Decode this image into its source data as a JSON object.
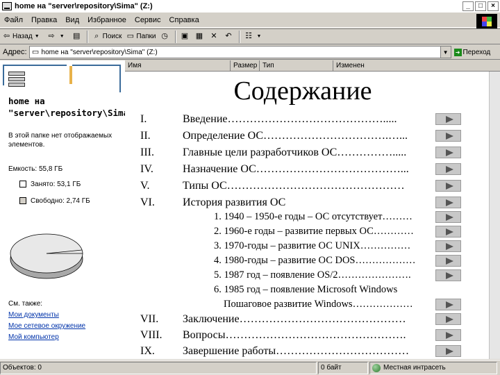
{
  "window": {
    "title": "home на \"server\\repository\\Sima\" (Z:)"
  },
  "menu": [
    "Файл",
    "Правка",
    "Вид",
    "Избранное",
    "Сервис",
    "Справка"
  ],
  "toolbar": {
    "back": "Назад",
    "search": "Поиск",
    "folders": "Папки"
  },
  "address": {
    "label": "Адрес:",
    "value": "home на \"server\\repository\\Sima\" (Z:)",
    "go": "Переход"
  },
  "columns": [
    "Имя",
    "Размер",
    "Тип",
    "Изменен"
  ],
  "left_panel": {
    "folder_title": "home на\n\"server\\repository\\Sima",
    "empty_text": "В этой папке нет отображаемых элементов.",
    "capacity": "Емкость: 55,8 ГБ",
    "used": "Занято: 53,1 ГБ",
    "free": "Свободно: 2,74 ГБ",
    "see_also": "См. также:",
    "links": [
      "Мои документы",
      "Мое сетевое окружение",
      "Мой компьютер"
    ],
    "used_color": "#ffffff",
    "free_color": "#d4d0c8"
  },
  "slide": {
    "title": "Содержание",
    "items": [
      {
        "num": "I.",
        "text": "Введение……………………………………....."
      },
      {
        "num": "II.",
        "text": "Определение ОС…………………………….…..."
      },
      {
        "num": "III.",
        "text": "Главные цели разработчиков ОС…………….....",
        "sep": true
      },
      {
        "num": "IV.",
        "text": "Назначение ОС…………………………………..."
      },
      {
        "num": "V.",
        "text": "Типы ОС…………………………………………"
      },
      {
        "num": "VI.",
        "text": "История развития ОС"
      }
    ],
    "subitems": [
      "1. 1940 – 1950-е годы – ОС отсутствует………",
      "2. 1960-е годы – развитие первых ОС…………",
      "3. 1970-годы – развитие ОС UNIX……………",
      "4. 1980-годы – развитие ОС DOS………………",
      "5. 1987 год – появление OS/2………………….",
      "6. 1985 год – появление Microsoft Windows",
      "   Пошаговое развитие Windows………………"
    ],
    "tail": [
      {
        "num": "VII.",
        "text": "Заключение………………………………………"
      },
      {
        "num": "VIII.",
        "text": "Вопросы…………………………………………."
      },
      {
        "num": "IX.",
        "text": "Завершение работы………………………………"
      }
    ]
  },
  "status": {
    "objects": "Объектов: 0",
    "size": "0 байт",
    "zone": "Местная интрасеть"
  }
}
